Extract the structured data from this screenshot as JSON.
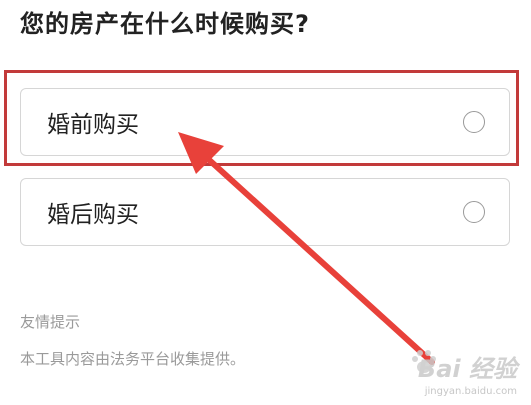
{
  "question": {
    "title": "您的房产在什么时候购买?"
  },
  "options": [
    {
      "label": "婚前购买",
      "selected": false
    },
    {
      "label": "婚后购买",
      "selected": false
    }
  ],
  "tip": {
    "title": "友情提示",
    "text": "本工具内容由法务平台收集提供。"
  },
  "annotation": {
    "highlight_color": "#c23a3a",
    "arrow_color": "#e8413a"
  },
  "watermark": {
    "logo": "Bai 经验",
    "url": "jingyan.baidu.com"
  }
}
